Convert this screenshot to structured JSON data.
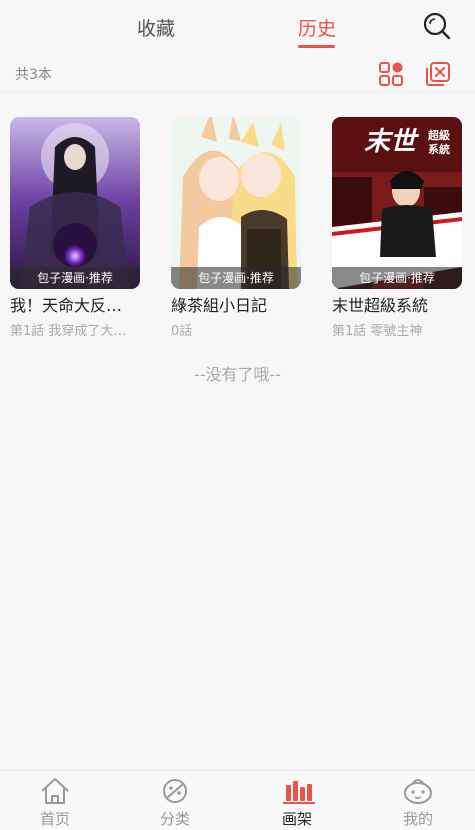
{
  "header": {
    "tabs": [
      {
        "label": "收藏",
        "active": false
      },
      {
        "label": "历史",
        "active": true
      }
    ],
    "accent_color": "#e8534a",
    "search_icon": "search-icon"
  },
  "toolbar": {
    "count_label": "共3本",
    "grid_icon": "grid-view-icon",
    "clear_icon": "clear-icon"
  },
  "books": [
    {
      "title": "我！天命大反…",
      "ribbon": "包子漫画·推荐",
      "progress": "第1話 我穿成了大…"
    },
    {
      "title": "綠茶組小日記",
      "ribbon": "包子漫画·推荐",
      "progress": "0話"
    },
    {
      "title": "末世超級系統",
      "ribbon": "包子漫画·推荐",
      "progress": "第1話 零號主神",
      "cover_text": {
        "main": "末世",
        "sub1": "超級",
        "sub2": "系統"
      }
    }
  ],
  "end_note": "--没有了哦--",
  "bottom_nav": [
    {
      "label": "首页",
      "icon": "home-icon",
      "active": false
    },
    {
      "label": "分类",
      "icon": "category-icon",
      "active": false
    },
    {
      "label": "画架",
      "icon": "bookshelf-icon",
      "active": true
    },
    {
      "label": "我的",
      "icon": "profile-icon",
      "active": false
    }
  ]
}
